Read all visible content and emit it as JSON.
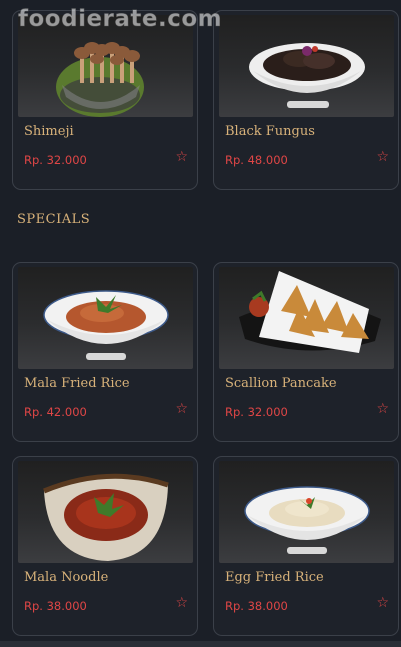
{
  "watermark": "foodierate.com",
  "section": {
    "title": "SPECIALS"
  },
  "items": [
    {
      "name": "Shimeji",
      "price": "Rp. 32.000",
      "icon": "star-outline-icon"
    },
    {
      "name": "Black Fungus",
      "price": "Rp. 48.000",
      "icon": "star-outline-icon"
    },
    {
      "name": "Mala Fried Rice",
      "price": "Rp. 42.000",
      "icon": "star-outline-icon"
    },
    {
      "name": "Scallion Pancake",
      "price": "Rp. 32.000",
      "icon": "star-outline-icon"
    },
    {
      "name": "Mala Noodle",
      "price": "Rp. 38.000",
      "icon": "star-outline-icon"
    },
    {
      "name": "Egg Fried Rice",
      "price": "Rp. 38.000",
      "icon": "star-outline-icon"
    }
  ],
  "colors": {
    "background": "#1b1f27",
    "accent_gold": "#d8b27a",
    "price_red": "#df4646",
    "card_border": "#3b4049"
  }
}
